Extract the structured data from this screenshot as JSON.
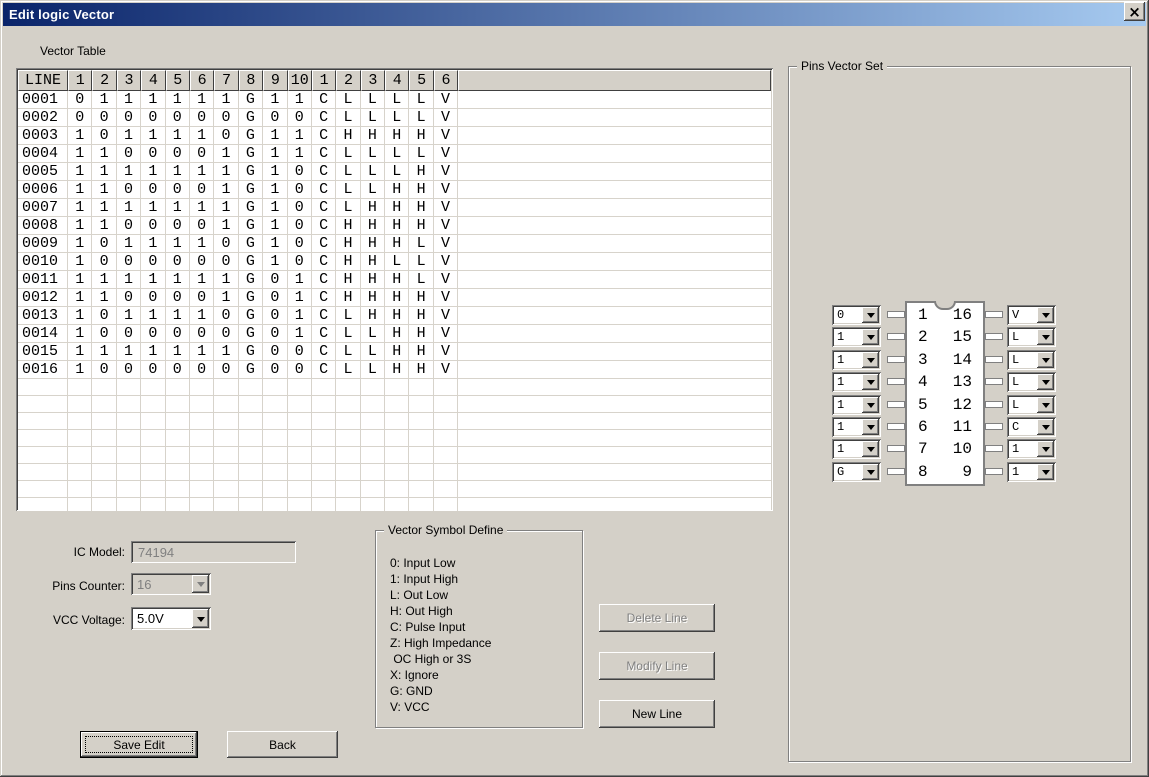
{
  "window": {
    "title": "Edit logic Vector",
    "close_label": "×"
  },
  "vector_table": {
    "label": "Vector Table",
    "columns": [
      "LINE",
      "1",
      "2",
      "3",
      "4",
      "5",
      "6",
      "7",
      "8",
      "9",
      "10",
      "1",
      "2",
      "3",
      "4",
      "5",
      "6"
    ],
    "rows": [
      [
        "0001",
        "0",
        "1",
        "1",
        "1",
        "1",
        "1",
        "1",
        "G",
        "1",
        "1",
        "C",
        "L",
        "L",
        "L",
        "L",
        "V"
      ],
      [
        "0002",
        "0",
        "0",
        "0",
        "0",
        "0",
        "0",
        "0",
        "G",
        "0",
        "0",
        "C",
        "L",
        "L",
        "L",
        "L",
        "V"
      ],
      [
        "0003",
        "1",
        "0",
        "1",
        "1",
        "1",
        "1",
        "0",
        "G",
        "1",
        "1",
        "C",
        "H",
        "H",
        "H",
        "H",
        "V"
      ],
      [
        "0004",
        "1",
        "1",
        "0",
        "0",
        "0",
        "0",
        "1",
        "G",
        "1",
        "1",
        "C",
        "L",
        "L",
        "L",
        "L",
        "V"
      ],
      [
        "0005",
        "1",
        "1",
        "1",
        "1",
        "1",
        "1",
        "1",
        "G",
        "1",
        "0",
        "C",
        "L",
        "L",
        "L",
        "H",
        "V"
      ],
      [
        "0006",
        "1",
        "1",
        "0",
        "0",
        "0",
        "0",
        "1",
        "G",
        "1",
        "0",
        "C",
        "L",
        "L",
        "H",
        "H",
        "V"
      ],
      [
        "0007",
        "1",
        "1",
        "1",
        "1",
        "1",
        "1",
        "1",
        "G",
        "1",
        "0",
        "C",
        "L",
        "H",
        "H",
        "H",
        "V"
      ],
      [
        "0008",
        "1",
        "1",
        "0",
        "0",
        "0",
        "0",
        "1",
        "G",
        "1",
        "0",
        "C",
        "H",
        "H",
        "H",
        "H",
        "V"
      ],
      [
        "0009",
        "1",
        "0",
        "1",
        "1",
        "1",
        "1",
        "0",
        "G",
        "1",
        "0",
        "C",
        "H",
        "H",
        "H",
        "L",
        "V"
      ],
      [
        "0010",
        "1",
        "0",
        "0",
        "0",
        "0",
        "0",
        "0",
        "G",
        "1",
        "0",
        "C",
        "H",
        "H",
        "L",
        "L",
        "V"
      ],
      [
        "0011",
        "1",
        "1",
        "1",
        "1",
        "1",
        "1",
        "1",
        "G",
        "0",
        "1",
        "C",
        "H",
        "H",
        "H",
        "L",
        "V"
      ],
      [
        "0012",
        "1",
        "1",
        "0",
        "0",
        "0",
        "0",
        "1",
        "G",
        "0",
        "1",
        "C",
        "H",
        "H",
        "H",
        "H",
        "V"
      ],
      [
        "0013",
        "1",
        "0",
        "1",
        "1",
        "1",
        "1",
        "0",
        "G",
        "0",
        "1",
        "C",
        "L",
        "H",
        "H",
        "H",
        "V"
      ],
      [
        "0014",
        "1",
        "0",
        "0",
        "0",
        "0",
        "0",
        "0",
        "G",
        "0",
        "1",
        "C",
        "L",
        "L",
        "H",
        "H",
        "V"
      ],
      [
        "0015",
        "1",
        "1",
        "1",
        "1",
        "1",
        "1",
        "1",
        "G",
        "0",
        "0",
        "C",
        "L",
        "L",
        "H",
        "H",
        "V"
      ],
      [
        "0016",
        "1",
        "0",
        "0",
        "0",
        "0",
        "0",
        "0",
        "G",
        "0",
        "0",
        "C",
        "L",
        "L",
        "H",
        "H",
        "V"
      ]
    ],
    "empty_rows": 9
  },
  "fields": {
    "ic_model": {
      "label": "IC Model:",
      "value": "74194",
      "enabled": false
    },
    "pins_counter": {
      "label": "Pins Counter:",
      "value": "16",
      "enabled": false
    },
    "vcc_voltage": {
      "label": "VCC Voltage:",
      "value": "5.0V",
      "enabled": true
    }
  },
  "symbol_define": {
    "title": "Vector Symbol Define",
    "lines": [
      "0: Input Low",
      "1: Input High",
      "L: Out Low",
      "H: Out High",
      "C: Pulse Input",
      "Z: High Impedance",
      " OC High or 3S",
      "X: Ignore",
      "G: GND",
      "V: VCC"
    ]
  },
  "buttons": {
    "delete_line": {
      "label": "Delete Line",
      "enabled": false
    },
    "modify_line": {
      "label": "Modify Line",
      "enabled": false
    },
    "new_line": {
      "label": "New Line",
      "enabled": true
    },
    "save_edit": {
      "label": "Save Edit",
      "enabled": true,
      "default": true
    },
    "back": {
      "label": "Back",
      "enabled": true
    }
  },
  "pins_vector_set": {
    "title": "Pins Vector Set",
    "left_pins": [
      {
        "pin": "1",
        "value": "0"
      },
      {
        "pin": "2",
        "value": "1"
      },
      {
        "pin": "3",
        "value": "1"
      },
      {
        "pin": "4",
        "value": "1"
      },
      {
        "pin": "5",
        "value": "1"
      },
      {
        "pin": "6",
        "value": "1"
      },
      {
        "pin": "7",
        "value": "1"
      },
      {
        "pin": "8",
        "value": "G"
      }
    ],
    "right_pins": [
      {
        "pin": "16",
        "value": "V"
      },
      {
        "pin": "15",
        "value": "L"
      },
      {
        "pin": "14",
        "value": "L"
      },
      {
        "pin": "13",
        "value": "L"
      },
      {
        "pin": "12",
        "value": "L"
      },
      {
        "pin": "11",
        "value": "C"
      },
      {
        "pin": "10",
        "value": "1"
      },
      {
        "pin": "9",
        "value": "1"
      }
    ]
  },
  "colors": {
    "titlebar_left": "#0a246a",
    "titlebar_right": "#a6caf0",
    "dialog_bg": "#d4d0c8"
  }
}
